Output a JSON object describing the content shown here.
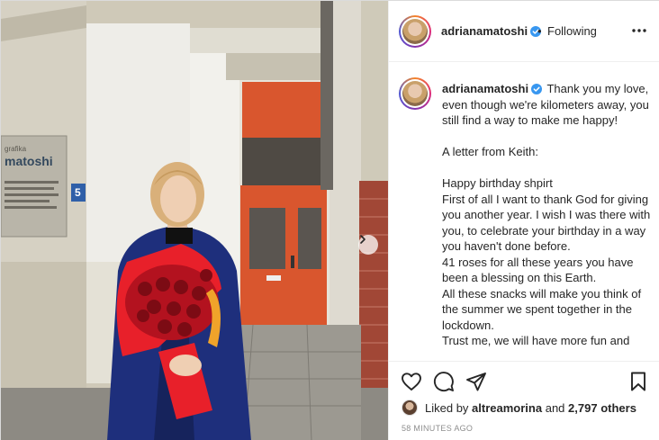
{
  "post": {
    "username": "adrianamatoshi",
    "follow_status": "Following",
    "caption_text": "Thank you my love, even though we're kilometers away, you still find a way to make me happy!\n\nA letter from Keith:\n\nHappy birthday shpirt\nFirst of all I want to thank God for giving you another year. I wish I was there with you, to celebrate your birthday in a way you haven't done before.\n41 roses for all these years you have been a blessing on this Earth.\nAll these snacks will make you think of the summer we spent together in the lockdown.\nTrust me, we will have more fun and",
    "liked_by_prefix": "Liked by",
    "liked_by_user": "altreamorina",
    "liked_by_and": "and",
    "liked_by_count": "2,797 others",
    "time_ago": "58 minutes ago"
  },
  "photo": {
    "sign_top": "grafika",
    "sign_brand": "matoshi",
    "house_number": "5"
  },
  "colors": {
    "verified": "#3897f0",
    "door": "#d9562e",
    "coat": "#1e2f7c",
    "roses": "#b3121f",
    "wrap": "#e8202a"
  },
  "icons": {
    "like": "heart-icon",
    "comment": "comment-bubble-icon",
    "share": "paper-plane-icon",
    "save": "bookmark-icon",
    "more": "more-options-icon",
    "next": "chevron-right-icon",
    "verified": "verified-badge-icon"
  }
}
